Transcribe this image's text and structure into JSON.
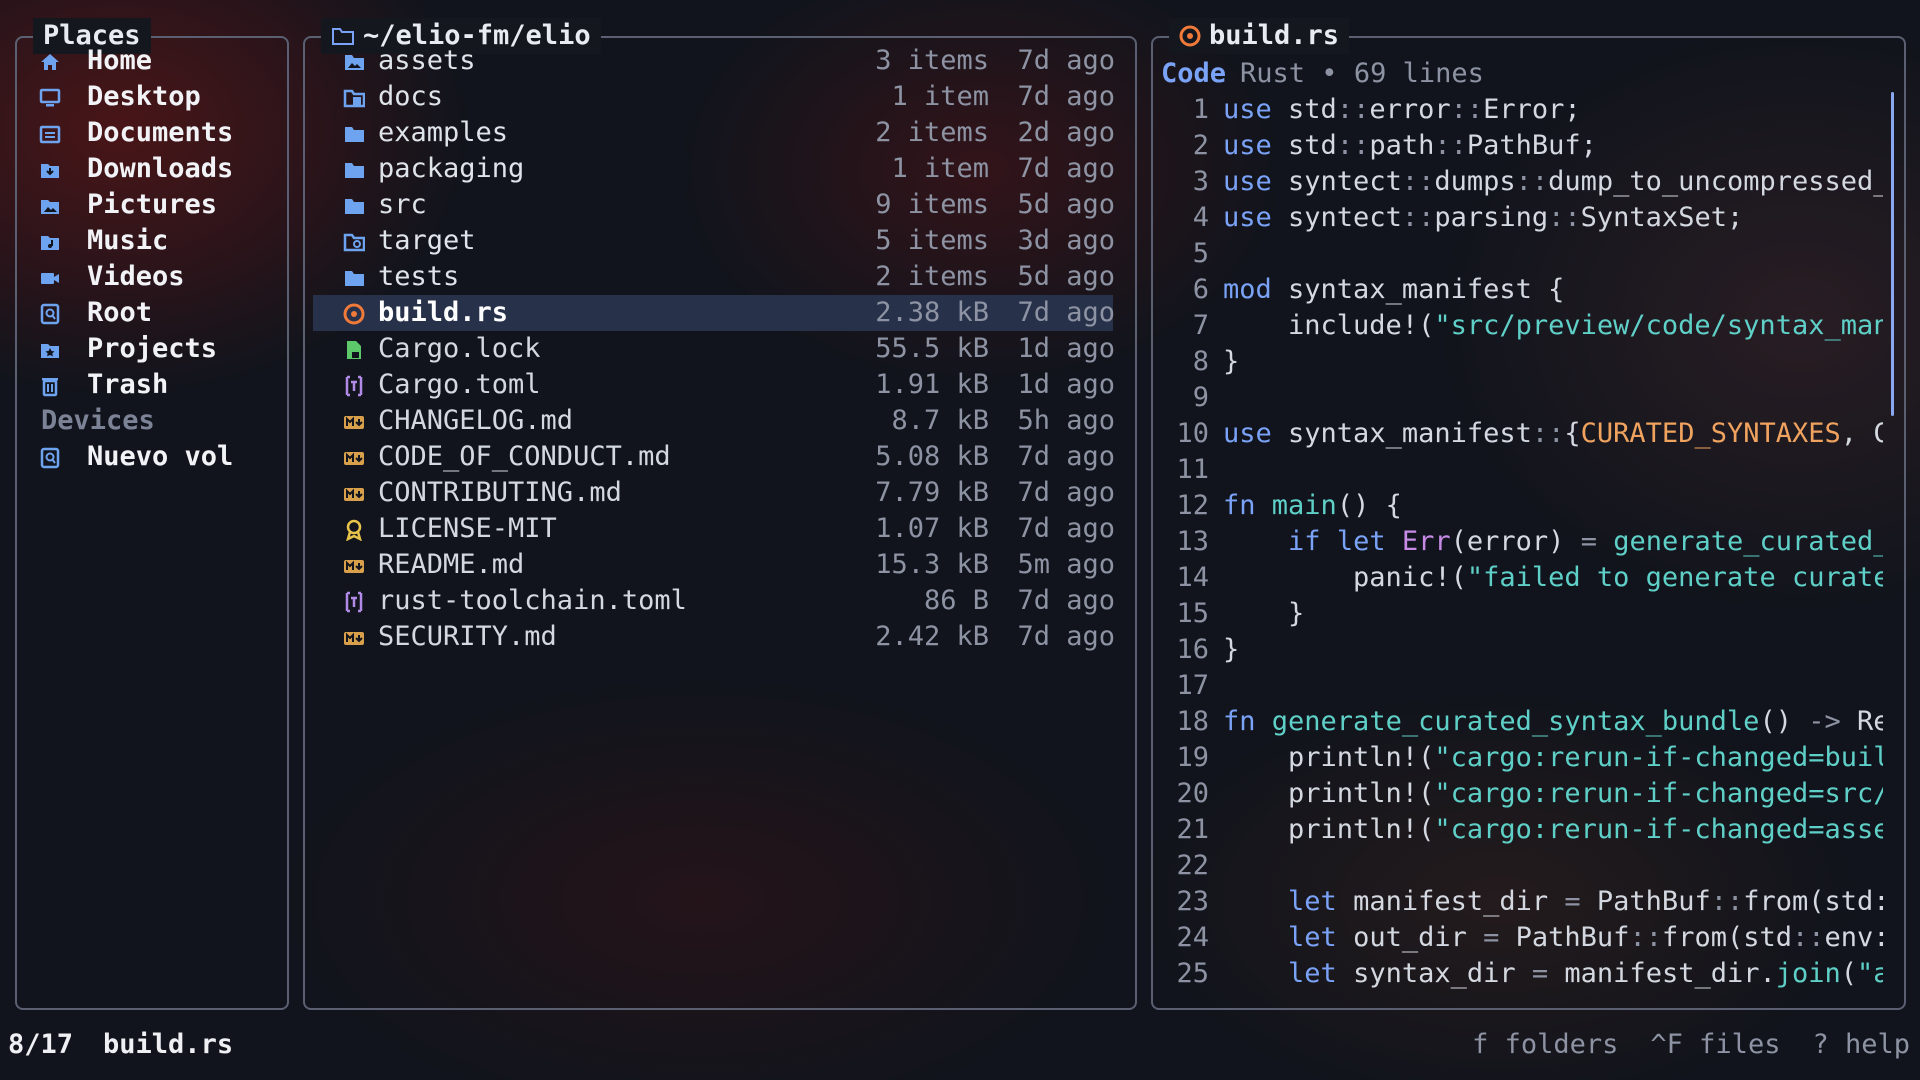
{
  "places": {
    "title": "Places",
    "items": [
      {
        "label": "Home",
        "icon": "home-icon"
      },
      {
        "label": "Desktop",
        "icon": "desktop-icon"
      },
      {
        "label": "Documents",
        "icon": "documents-icon"
      },
      {
        "label": "Downloads",
        "icon": "downloads-icon"
      },
      {
        "label": "Pictures",
        "icon": "pictures-icon"
      },
      {
        "label": "Music",
        "icon": "music-icon"
      },
      {
        "label": "Videos",
        "icon": "videos-icon"
      },
      {
        "label": "Root",
        "icon": "root-icon"
      },
      {
        "label": "Projects",
        "icon": "projects-icon"
      },
      {
        "label": "Trash",
        "icon": "trash-icon"
      }
    ],
    "devices_label": "Devices",
    "devices": [
      {
        "label": "Nuevo vol",
        "icon": "drive-icon"
      }
    ]
  },
  "files": {
    "title": "~/elio-fm/elio",
    "entries": [
      {
        "name": "assets",
        "size": "3 items",
        "age": "7d ago",
        "type": "dir",
        "icon": "folder-image-icon"
      },
      {
        "name": "docs",
        "size": "1 item",
        "age": "7d ago",
        "type": "dir",
        "icon": "folder-docs-icon"
      },
      {
        "name": "examples",
        "size": "2 items",
        "age": "2d ago",
        "type": "dir",
        "icon": "folder-icon"
      },
      {
        "name": "packaging",
        "size": "1 item",
        "age": "7d ago",
        "type": "dir",
        "icon": "folder-icon"
      },
      {
        "name": "src",
        "size": "9 items",
        "age": "5d ago",
        "type": "dir",
        "icon": "folder-icon"
      },
      {
        "name": "target",
        "size": "5 items",
        "age": "3d ago",
        "type": "dir",
        "icon": "folder-target-icon"
      },
      {
        "name": "tests",
        "size": "2 items",
        "age": "5d ago",
        "type": "dir",
        "icon": "folder-icon"
      },
      {
        "name": "build.rs",
        "size": "2.38 kB",
        "age": "7d ago",
        "type": "file",
        "icon": "rust-icon",
        "selected": true
      },
      {
        "name": "Cargo.lock",
        "size": "55.5 kB",
        "age": "1d ago",
        "type": "file",
        "icon": "lock-file-icon"
      },
      {
        "name": "Cargo.toml",
        "size": "1.91 kB",
        "age": "1d ago",
        "type": "file",
        "icon": "toml-icon"
      },
      {
        "name": "CHANGELOG.md",
        "size": "8.7 kB",
        "age": "5h ago",
        "type": "file",
        "icon": "markdown-icon"
      },
      {
        "name": "CODE_OF_CONDUCT.md",
        "size": "5.08 kB",
        "age": "7d ago",
        "type": "file",
        "icon": "markdown-icon"
      },
      {
        "name": "CONTRIBUTING.md",
        "size": "7.79 kB",
        "age": "7d ago",
        "type": "file",
        "icon": "markdown-icon"
      },
      {
        "name": "LICENSE-MIT",
        "size": "1.07 kB",
        "age": "7d ago",
        "type": "file",
        "icon": "license-icon"
      },
      {
        "name": "README.md",
        "size": "15.3 kB",
        "age": "5m ago",
        "type": "file",
        "icon": "markdown-icon"
      },
      {
        "name": "rust-toolchain.toml",
        "size": "86 B",
        "age": "7d ago",
        "type": "file",
        "icon": "toml-icon"
      },
      {
        "name": "SECURITY.md",
        "size": "2.42 kB",
        "age": "7d ago",
        "type": "file",
        "icon": "markdown-icon"
      }
    ]
  },
  "preview": {
    "title": "build.rs",
    "title_icon": "rust-icon",
    "tab": "Code",
    "meta": "Rust • 69 lines",
    "lines": [
      "use std::error::Error;",
      "use std::path::PathBuf;",
      "use syntect::dumps::dump_to_uncompressed_",
      "use syntect::parsing::SyntaxSet;",
      "",
      "mod syntax_manifest {",
      "    include!(\"src/preview/code/syntax_man",
      "}",
      "",
      "use syntax_manifest::{CURATED_SYNTAXES, C",
      "",
      "fn main() {",
      "    if let Err(error) = generate_curated_",
      "        panic!(\"failed to generate curate",
      "    }",
      "}",
      "",
      "fn generate_curated_syntax_bundle() -> Re",
      "    println!(\"cargo:rerun-if-changed=buil",
      "    println!(\"cargo:rerun-if-changed=src/",
      "    println!(\"cargo:rerun-if-changed=asse",
      "",
      "    let manifest_dir = PathBuf::from(std:",
      "    let out_dir = PathBuf::from(std::env:",
      "    let syntax_dir = manifest_dir.join(\"a"
    ]
  },
  "status": {
    "position": "8/17",
    "current": "build.rs",
    "hints": [
      "f folders",
      "^F files",
      "? help"
    ]
  },
  "colors": {
    "accent": "#7aa2f7",
    "string": "#5fd0c8",
    "selection": "#27314a",
    "rust": "#f07a3a",
    "markdown": "#d9a04c",
    "toml": "#b08ae6",
    "lock": "#5cc86a"
  }
}
